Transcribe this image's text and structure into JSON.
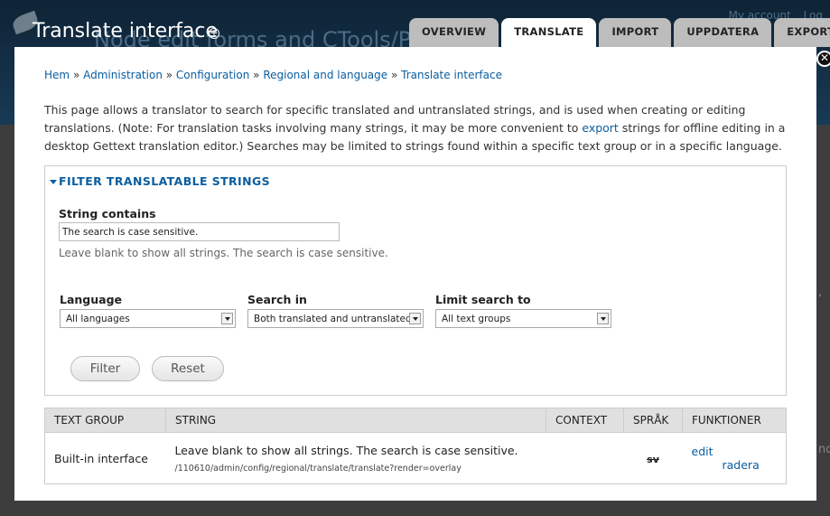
{
  "background": {
    "title": "Node edit forms and CTools/Pa",
    "links": [
      "My account",
      "Log"
    ],
    "side_text": [
      ",",
      "nor"
    ]
  },
  "overlay": {
    "title": "Translate interface",
    "tabs": [
      {
        "label": "OVERVIEW",
        "active": false
      },
      {
        "label": "TRANSLATE",
        "active": true
      },
      {
        "label": "IMPORT",
        "active": false
      },
      {
        "label": "UPPDATERA",
        "active": false
      },
      {
        "label": "EXPORT",
        "active": false
      }
    ],
    "close_symbol": "✕"
  },
  "breadcrumb": {
    "items": [
      "Hem",
      "Administration",
      "Configuration",
      "Regional and language",
      "Translate interface"
    ],
    "separator": "»"
  },
  "intro": {
    "before_link": "This page allows a translator to search for specific translated and untranslated strings, and is used when creating or editing translations. (Note: For translation tasks involving many strings, it may be more convenient to ",
    "link": "export",
    "after_link": " strings for offline editing in a desktop Gettext translation editor.) Searches may be limited to strings found within a specific text group or in a specific language."
  },
  "filter": {
    "legend": "FILTER TRANSLATABLE STRINGS",
    "string_contains_label": "String contains",
    "string_contains_value": "The search is case sensitive.",
    "string_contains_description": "Leave blank to show all strings. The search is case sensitive.",
    "language_label": "Language",
    "language_value": "All languages",
    "search_in_label": "Search in",
    "search_in_value": "Both translated and untranslated s",
    "limit_label": "Limit search to",
    "limit_value": "All text groups",
    "filter_button": "Filter",
    "reset_button": "Reset"
  },
  "table": {
    "headers": [
      "TEXT GROUP",
      "STRING",
      "CONTEXT",
      "SPRÅK",
      "FUNKTIONER"
    ],
    "rows": [
      {
        "text_group": "Built-in interface",
        "string": "Leave blank to show all strings. The search is case sensitive.",
        "path": "/110610/admin/config/regional/translate/translate?render=overlay",
        "context": "",
        "language": "sv",
        "edit": "edit",
        "delete": "radera"
      }
    ]
  },
  "colors": {
    "link": "#0b5ea0",
    "header_bg": "#183a55",
    "tab_inactive": "#bdbdbd",
    "tab_active": "#ffffff"
  }
}
